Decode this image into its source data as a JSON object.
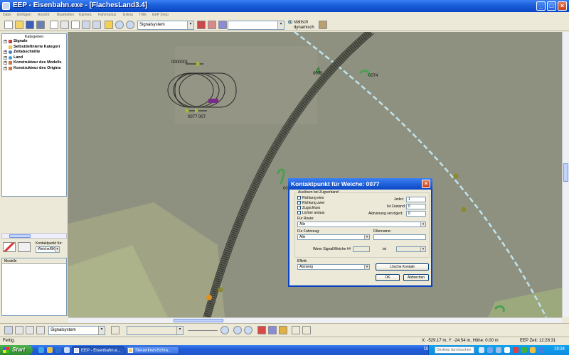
{
  "window": {
    "title": "EEP - Eisenbahn.exe - [FlachesLand3.4]",
    "min_symbol": "_",
    "max_symbol": "□",
    "close_symbol": "×"
  },
  "menu": [
    "Datei",
    "Einfügen",
    "Ansicht",
    "Bearbeiten",
    "Kamera",
    "Fahrmodus",
    "Extras",
    "Hilfe",
    "EEP Shop"
  ],
  "toolbar": {
    "layer_select": "Signalsystem",
    "mode_combo": "",
    "radio_static": "statisch",
    "radio_dynamic": "dynamisch"
  },
  "sidebar": {
    "header": "Kategorien",
    "items": [
      {
        "label": "Signale",
        "expander": "+"
      },
      {
        "label": "Selbstdefinierte Kategori",
        "expander": ""
      },
      {
        "label": "Zeitabschnitte",
        "expander": "+"
      },
      {
        "label": "Land",
        "expander": "+"
      },
      {
        "label": "Konstrukteur des Modells",
        "expander": "+"
      },
      {
        "label": "Konstrukteur des Origina",
        "expander": "+"
      }
    ],
    "contact_label": "Kontaktpunkt für:",
    "contact_value": "Weiche/BKA",
    "models_header": "Modelle"
  },
  "scene": {
    "labels": [
      "0000001",
      "0075",
      "0074",
      "0077",
      "007",
      "0077 007"
    ],
    "track_color": "#5a5d52",
    "path_color": "#bfe4ee",
    "object_color": "#7a2a8a"
  },
  "dialog": {
    "title": "Kontaktpunkt für Weiche: 0077",
    "close_symbol": "×",
    "group_label": "Auslösen bei Zugverband:",
    "checkboxes": [
      {
        "label": "Richtung eins",
        "checked": false
      },
      {
        "label": "Richtung zwei",
        "checked": true
      },
      {
        "label": "Zugschluss",
        "checked": false
      },
      {
        "label": "Lichter an/aus",
        "checked": false
      }
    ],
    "jeder_label": "Jeder:",
    "jeder_value": "1",
    "zustand_label": "Ist Zustand:",
    "zustand_value": "0",
    "verz_label": "Aktivierung verzögert:",
    "verz_value": "0",
    "route_label": "Für Route:",
    "route_value": "Alle",
    "fahrzeug_label": "Für Fahrzeug:",
    "fahrzeug_value": "Alle",
    "filter_label": "Filtername:",
    "filter_value": "",
    "wenn_label": "Wenn Signal/Weiche ##",
    "wenn_value": "",
    "ist_label": "ist",
    "ist_value": "",
    "effekt_label": "Effekt:",
    "effekt_value": "Abzweig",
    "delete_button": "Lösche Kontakt",
    "ok_button": "OK",
    "cancel_button": "Abbrechen",
    "drop_symbol": "▾"
  },
  "bottom_toolbar": {
    "layer_select": "Signalsystem",
    "drop_symbol": "▾"
  },
  "status": {
    "left": "Fertig.",
    "coords": "X: -529.17 m, Y: -24.54 m, Höhe: 0.00 m",
    "time": "EEP Zeit: 12:28:31"
  },
  "taskbar": {
    "start_label": "Start",
    "task1": "EEP - Eisenbahn.e...",
    "task2": "SteuerkreisSchra...",
    "lang": "DE",
    "search_placeholder": "Desktop durchsuchen",
    "clock": "19:34"
  }
}
